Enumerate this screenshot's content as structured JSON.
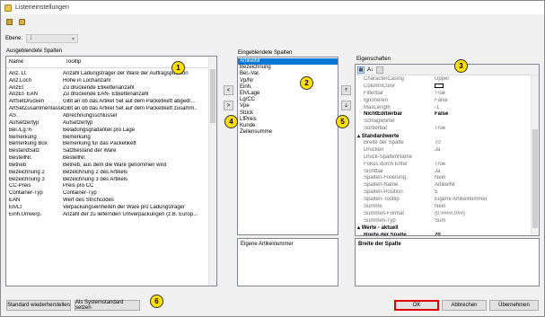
{
  "window": {
    "title": "Listeneinstellungen"
  },
  "toolbar": {
    "icons": [
      "clipboard-icon",
      "book-icon"
    ]
  },
  "ebene": {
    "label": "Ebene:",
    "value": "1"
  },
  "hidden": {
    "title": "Ausgeblendete Spalten",
    "col_name": "Name",
    "col_tooltip": "Tooltip",
    "rows": [
      [
        "Anz. Lt.",
        "Anzahl Ladungsträger der Ware der Auftragsposition"
      ],
      [
        "Anz.Loch",
        "Höhe in Lochanzahl"
      ],
      [
        "AnzEt",
        "Zu druckende Etikettenanzahl"
      ],
      [
        "AnzEt- EAN",
        "Zu druckende EAN- Etikettenanzahl"
      ],
      [
        "ArtSetDrucken",
        "Gibt an ob das Artikel Set auf dem Packetikett abgedr..."
      ],
      [
        "ArtSetZusammenfassen",
        "Gibt an ob das Artikel Set auf dem Packetikett zusamm..."
      ],
      [
        "AS",
        "Abrechnungsschlüssel"
      ],
      [
        "Aufsetzertyp",
        "Aufsetzertyp"
      ],
      [
        "Bel./Lg.%",
        "Beladungsgradanteil pro Lage"
      ],
      [
        "Bemerkung",
        "Bemerkung"
      ],
      [
        "Bemerkung Box",
        "Bemerkung für das Packetikett"
      ],
      [
        "BestandSatz",
        "Satzbestand der Ware"
      ],
      [
        "BestellNr.",
        "BestellNr."
      ],
      [
        "Betrieb",
        "Betrieb, aus dem die Ware genommen wird"
      ],
      [
        "Bezeichnung 2",
        "Bezeichnung 2 des Artikels"
      ],
      [
        "Bezeichnung 3",
        "Bezeichnung 3 des Artikels"
      ],
      [
        "CC-Preis",
        "Preis pro CC"
      ],
      [
        "Container-Typ",
        "Container-Typ"
      ],
      [
        "EAN",
        "Wert des Strichcodes"
      ],
      [
        "Eh/Lt",
        "Verpackungseinheiten der Ware pro Ladungsträger"
      ],
      [
        "Einh.Umverp.",
        "Anzahl der zu liefernden Umverpackungen (z.B. Europ..."
      ]
    ]
  },
  "shown": {
    "title": "Eingeblendete Spalten",
    "items": [
      "ArtikelNr",
      "Bezeichnung",
      "Bel.-Var.",
      "Vp/Nr",
      "Einh.",
      "Eh/Lage",
      "Lg/CC",
      "Vpe",
      "Stück",
      "LfPreis",
      "Kunde",
      "Zeilensumme"
    ],
    "selected": 0,
    "tooltip_display": "Eigene Artikelnummer"
  },
  "props": {
    "title": "Eigenschaften",
    "rows": [
      {
        "k": "CharacterCasing",
        "v": "Upper"
      },
      {
        "k": "ColumnColor",
        "v": "",
        "color": true
      },
      {
        "k": "Filterbar",
        "v": "True"
      },
      {
        "k": "Ignorieren",
        "v": "False"
      },
      {
        "k": "MaxLength",
        "v": "-1"
      },
      {
        "k": "NichtEditierbar",
        "v": "False",
        "bold": true
      },
      {
        "k": "Schlagwörter",
        "v": ""
      },
      {
        "k": "Sortierbar",
        "v": "True"
      },
      {
        "cat": "Standardwerte"
      },
      {
        "k": "Breite der Spalte",
        "v": "70"
      },
      {
        "k": "Drucken",
        "v": "Ja"
      },
      {
        "k": "Druck-SpaltenName",
        "v": ""
      },
      {
        "k": "Fokus durch Enter",
        "v": "True"
      },
      {
        "k": "Sichtbar",
        "v": "Ja"
      },
      {
        "k": "Spalten-Fixierung",
        "v": "Nein"
      },
      {
        "k": "Spalten-Name",
        "v": "ArtikelNr"
      },
      {
        "k": "Spalten-Position",
        "v": "5"
      },
      {
        "k": "Spalten-Tooltip",
        "v": "Eigene Artikelnummer"
      },
      {
        "k": "Summe",
        "v": "Nein"
      },
      {
        "k": "Summen-Format",
        "v": "{0:####,0##}"
      },
      {
        "k": "Summen-Typ",
        "v": "Sum"
      },
      {
        "cat": "Werte - aktuell"
      },
      {
        "k": "Breite der Spalte",
        "v": "70",
        "bold": true
      },
      {
        "k": "Fixiert",
        "v": "Nein",
        "bold": true
      }
    ],
    "description": "Breite der Spalte"
  },
  "buttons": {
    "restore": "Standard wiederherstellen",
    "set_system": "Als Systemstandard setzen",
    "ok": "OK",
    "cancel": "Abbrechen",
    "apply": "Übernehmen"
  },
  "badges": [
    "1",
    "2",
    "3",
    "4",
    "5",
    "6"
  ],
  "colors": {
    "highlight": "#0078d7",
    "badge": "#ffe000",
    "ok_border": "#e00000"
  }
}
